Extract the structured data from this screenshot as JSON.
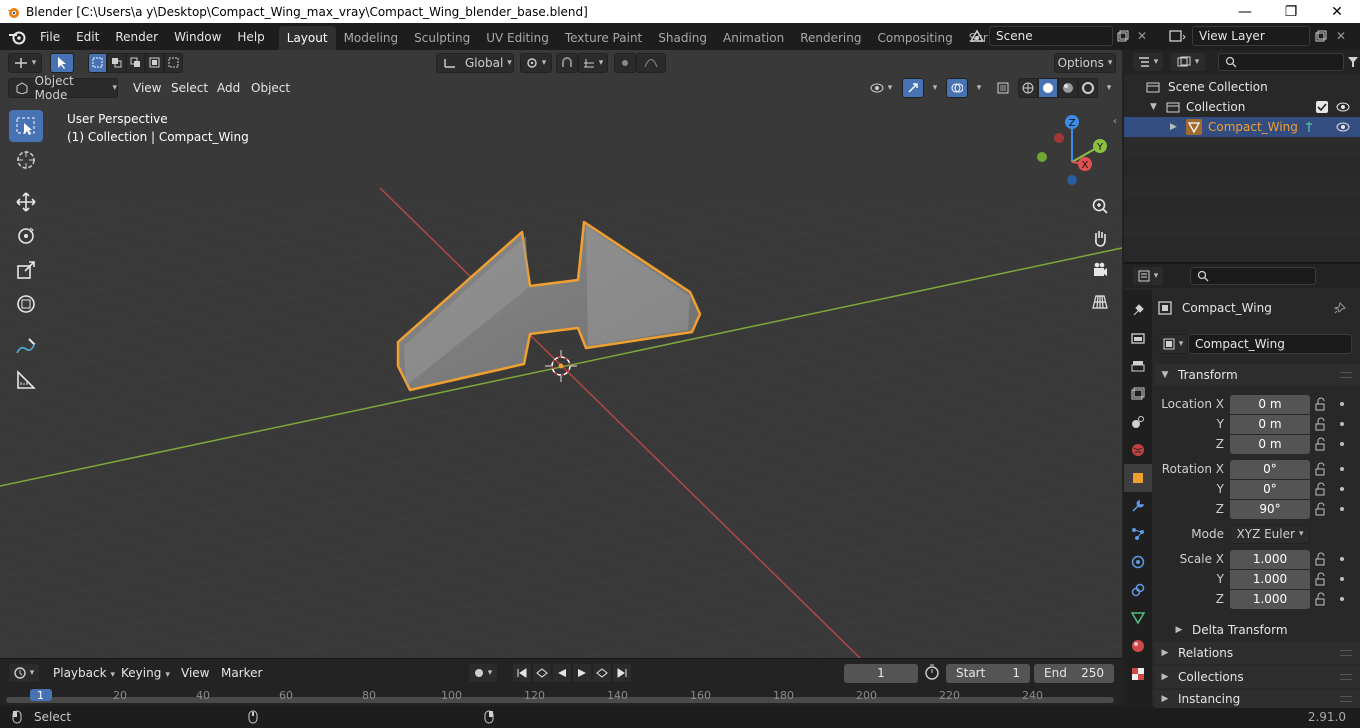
{
  "window": {
    "title": "Blender [C:\\Users\\a y\\Desktop\\Compact_Wing_max_vray\\Compact_Wing_blender_base.blend]",
    "minimize": "—",
    "maximize": "❐",
    "close": "✕"
  },
  "menu": [
    "File",
    "Edit",
    "Render",
    "Window",
    "Help"
  ],
  "workspaces": [
    "Layout",
    "Modeling",
    "Sculpting",
    "UV Editing",
    "Texture Paint",
    "Shading",
    "Animation",
    "Rendering",
    "Compositing",
    "Scripting"
  ],
  "active_workspace": "Layout",
  "scene": {
    "name": "Scene",
    "view_layer": "View Layer"
  },
  "viewport": {
    "transform_orientation": "Global",
    "options_label": "Options",
    "mode": "Object Mode",
    "menus": [
      "View",
      "Select",
      "Add",
      "Object"
    ],
    "info_line1": "User Perspective",
    "info_line2": "(1) Collection | Compact_Wing",
    "gizmo": {
      "x": "X",
      "y": "Y",
      "z": "Z"
    }
  },
  "timeline": {
    "menus": [
      "Playback",
      "Keying",
      "View",
      "Marker"
    ],
    "current_frame": "1",
    "start_label": "Start",
    "start_value": "1",
    "end_label": "End",
    "end_value": "250",
    "ruler_ticks": [
      "1",
      "20",
      "40",
      "60",
      "80",
      "100",
      "120",
      "140",
      "160",
      "180",
      "200",
      "220",
      "240"
    ]
  },
  "status": {
    "left": "Select",
    "version": "2.91.0"
  },
  "outliner": {
    "root": "Scene Collection",
    "collection": "Collection",
    "object": "Compact_Wing"
  },
  "properties": {
    "object_name": "Compact_Wing",
    "data_name": "Compact_Wing",
    "transform_label": "Transform",
    "location": {
      "label_x": "Location X",
      "label_y": "Y",
      "label_z": "Z",
      "x": "0 m",
      "y": "0 m",
      "z": "0 m"
    },
    "rotation": {
      "label_x": "Rotation X",
      "label_y": "Y",
      "label_z": "Z",
      "x": "0°",
      "y": "0°",
      "z": "90°"
    },
    "mode_label": "Mode",
    "mode_value": "XYZ Euler",
    "scale": {
      "label_x": "Scale X",
      "label_y": "Y",
      "label_z": "Z",
      "x": "1.000",
      "y": "1.000",
      "z": "1.000"
    },
    "delta_transform": "Delta Transform",
    "relations": "Relations",
    "collections": "Collections",
    "instancing": "Instancing"
  },
  "colors": {
    "accent": "#4772b3",
    "selection_outline": "#f0a030",
    "x_axis": "#e05050",
    "y_axis": "#8cc040",
    "z_axis": "#3c8ce8"
  }
}
